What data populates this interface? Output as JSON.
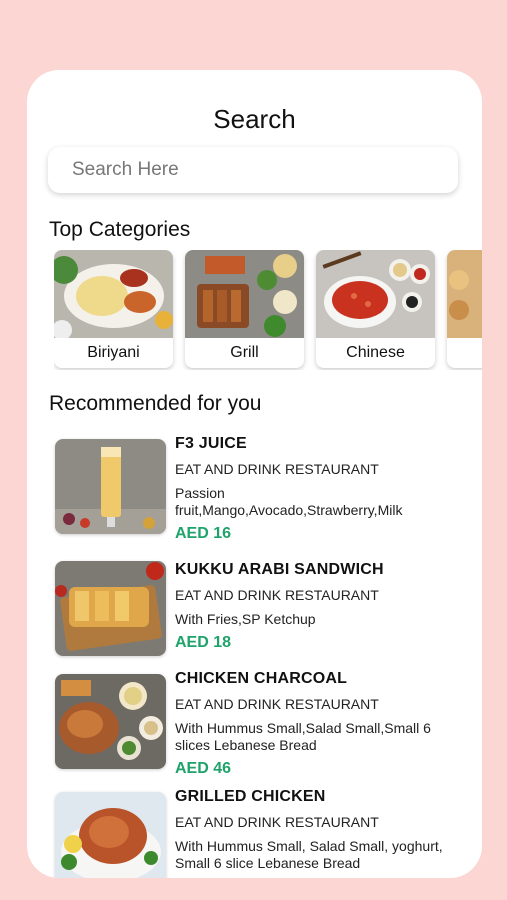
{
  "header": {
    "title": "Search"
  },
  "search": {
    "placeholder": "Search Here"
  },
  "categories": {
    "title": "Top Categories",
    "items": [
      {
        "label": "Biriyani"
      },
      {
        "label": "Grill"
      },
      {
        "label": "Chinese"
      }
    ]
  },
  "recommended": {
    "title": "Recommended for you",
    "items": [
      {
        "name": "F3 JUICE",
        "restaurant": "EAT AND DRINK RESTAURANT",
        "desc": "Passion fruit,Mango,Avocado,Strawberry,Milk",
        "price": "AED 16"
      },
      {
        "name": "KUKKU ARABI SANDWICH",
        "restaurant": "EAT AND DRINK RESTAURANT",
        "desc": "With Fries,SP Ketchup",
        "price": "AED 18"
      },
      {
        "name": "CHICKEN CHARCOAL",
        "restaurant": "EAT AND DRINK RESTAURANT",
        "desc": "With Hummus Small,Salad Small,Small 6 slices Lebanese Bread",
        "price": "AED 46"
      },
      {
        "name": "GRILLED CHICKEN",
        "restaurant": "EAT AND DRINK RESTAURANT",
        "desc": "With Hummus Small, Salad Small, yoghurt, Small 6 slice Lebanese Bread",
        "price": ""
      }
    ]
  },
  "colors": {
    "background": "#fcd6d2",
    "price": "#1fa36b"
  }
}
